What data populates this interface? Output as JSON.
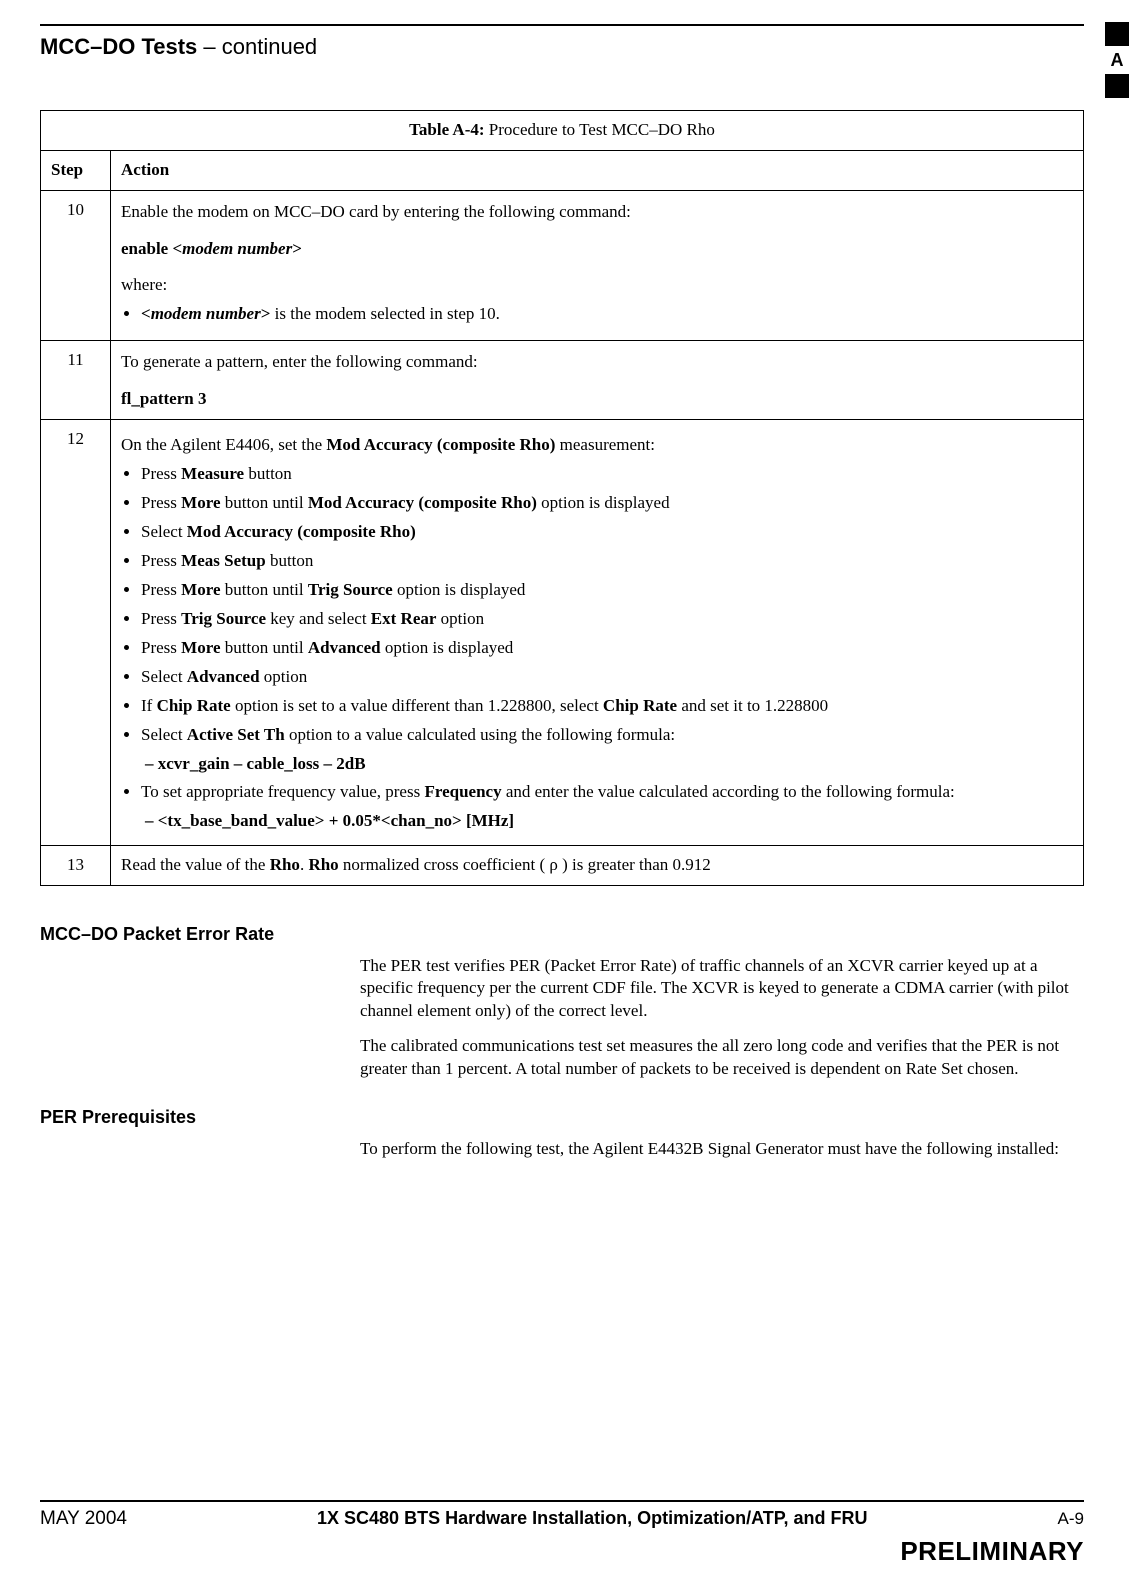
{
  "header": {
    "bold": "MCC–DO Tests",
    "rest": " – continued"
  },
  "side_tab": {
    "letter": "A"
  },
  "table": {
    "title_label": "Table A-4:",
    "title_text": " Procedure to Test MCC–DO Rho",
    "col_step": "Step",
    "col_action": "Action",
    "row10": {
      "step": "10",
      "line1": "Enable the modem on MCC–DO card by entering the following command:",
      "cmd_prefix": "enable <",
      "cmd_param": "modem number",
      "cmd_suffix": ">",
      "where": "where:",
      "bullet_pre": "<",
      "bullet_param": "modem number",
      "bullet_mid": ">",
      "bullet_end": " is the modem selected in step 10."
    },
    "row11": {
      "step": "11",
      "line1": "To generate a pattern, enter the following command:",
      "cmd": "fl_pattern 3"
    },
    "row12": {
      "step": "12",
      "intro_a": "On the Agilent E4406, set the ",
      "intro_b": "Mod Accuracy (composite Rho)",
      "intro_c": " measurement:",
      "b1a": "Press ",
      "b1b": "Measure",
      "b1c": " button",
      "b2a": "Press ",
      "b2b": "More",
      "b2c": " button until ",
      "b2d": "Mod Accuracy (composite Rho)",
      "b2e": " option is displayed",
      "b3a": "Select ",
      "b3b": "Mod Accuracy (composite Rho)",
      "b4a": "Press ",
      "b4b": "Meas Setup",
      "b4c": " button",
      "b5a": "Press ",
      "b5b": "More",
      "b5c": " button until ",
      "b5d": "Trig Source",
      "b5e": " option is displayed",
      "b6a": "Press ",
      "b6b": "Trig Source",
      "b6c": " key and select ",
      "b6d": "Ext Rear",
      "b6e": " option",
      "b7a": "Press ",
      "b7b": "More",
      "b7c": " button until ",
      "b7d": "Advanced",
      "b7e": " option is displayed",
      "b8a": "Select ",
      "b8b": "Advanced",
      "b8c": " option",
      "b9a": "If ",
      "b9b": "Chip Rate",
      "b9c": " option is set to a value different than 1.228800, select ",
      "b9d": "Chip Rate",
      "b9e": " and set it to 1.228800",
      "b10a": "Select ",
      "b10b": "Active Set Th",
      "b10c": " option to a value calculated using the following formula:",
      "s1": "xcvr_gain – cable_loss – 2dB",
      "b11a": "To set appropriate frequency value,  press ",
      "b11b": "Frequency",
      "b11c": " and enter the value calculated according to the following formula:",
      "s2": "<tx_base_band_value> + 0.05*<chan_no> [MHz]"
    },
    "row13": {
      "step": "13",
      "a": "Read the value of the ",
      "b": "Rho",
      "c1": ". ",
      "c2": "Rho",
      "d": " normalized cross coefficient ( ρ ) is greater than 0.912"
    }
  },
  "sections": {
    "per_title": "MCC–DO Packet Error Rate",
    "per_p1": "The PER test verifies PER (Packet Error Rate) of traffic channels of an XCVR carrier keyed up at a specific frequency per the current CDF file. The XCVR is keyed to generate a CDMA carrier (with pilot channel element only) of the correct level.",
    "per_p2": "The calibrated communications test set measures the all zero long code and verifies that the PER is not greater than 1 percent. A total number of packets to be received is dependent on Rate Set chosen.",
    "prereq_title": "PER Prerequisites",
    "prereq_p1": "To perform the following test, the Agilent E4432B Signal Generator must have the following installed:"
  },
  "footer": {
    "date": "MAY 2004",
    "title": "1X SC480 BTS Hardware Installation, Optimization/ATP, and FRU",
    "page": "A-9",
    "preliminary": "PRELIMINARY"
  }
}
